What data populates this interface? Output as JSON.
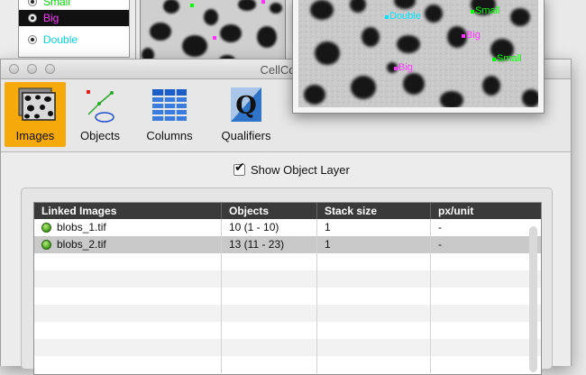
{
  "object_list": {
    "items": [
      {
        "label": "Small",
        "color": "#00ff00",
        "selected": false
      },
      {
        "label": "Big",
        "color": "#ff33ff",
        "selected": true
      },
      {
        "label": "Double",
        "color": "#00e5ff",
        "selected": false
      }
    ]
  },
  "image_window": {
    "markers": [
      {
        "label": "Double",
        "color": "#00e5ff"
      },
      {
        "label": "Small",
        "color": "#00ff00"
      },
      {
        "label": "Big",
        "color": "#ff33ff"
      },
      {
        "label": "Small",
        "color": "#00ff00"
      },
      {
        "label": "Big",
        "color": "#ff33ff"
      }
    ]
  },
  "window": {
    "title": "CellCount"
  },
  "toolbar": {
    "items": [
      {
        "label": "Images",
        "icon": "images-icon",
        "active": true
      },
      {
        "label": "Objects",
        "icon": "objects-icon",
        "active": false
      },
      {
        "label": "Columns",
        "icon": "columns-icon",
        "active": false
      },
      {
        "label": "Qualifiers",
        "icon": "qualifiers-icon",
        "active": false
      }
    ],
    "qualifier_glyph": "Q"
  },
  "show_layer": {
    "label": "Show Object Layer",
    "checked": true,
    "check_glyph": "✔"
  },
  "table": {
    "columns": [
      "Linked Images",
      "Objects",
      "Stack size",
      "px/unit"
    ],
    "rows": [
      {
        "name": "blobs_1.tif",
        "objects": "10 (1 - 10)",
        "stack": "1",
        "pxunit": "-"
      },
      {
        "name": "blobs_2.tif",
        "objects": "13 (11 - 23)",
        "stack": "1",
        "pxunit": "-"
      }
    ]
  },
  "colors": {
    "accent_active": "#f5a90b",
    "header_bg": "#3a3a3a"
  }
}
